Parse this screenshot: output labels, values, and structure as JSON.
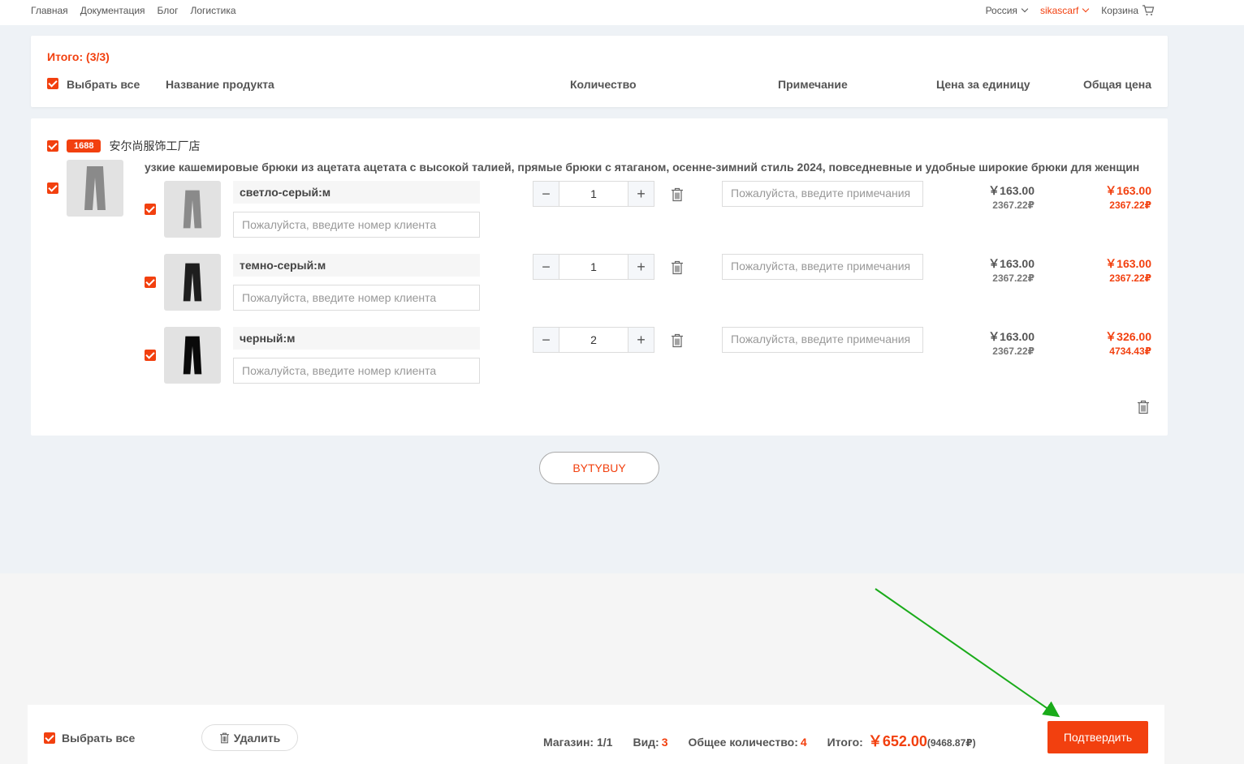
{
  "nav": {
    "links": [
      "Главная",
      "Документация",
      "Блог",
      "Логистика"
    ],
    "region": "Россия",
    "user": "sikascarf",
    "cart": "Корзина"
  },
  "header": {
    "total_label": "Итого:  (3/3)",
    "select_all": "Выбрать все",
    "col_product": "Название продукта",
    "col_qty": "Количество",
    "col_note": "Примечание",
    "col_unit": "Цена за единицу",
    "col_total": "Общая цена"
  },
  "store": {
    "badge": "1688",
    "name": "安尔尚服饰工厂店",
    "product_title": "узкие кашемировые брюки из ацетата ацетата с высокой талией, прямые брюки с ятаганом, осенне-зимний стиль 2024, повседневные и удобные широкие брюки для женщин",
    "variants": [
      {
        "name": "светло-серый:м",
        "qty": "1",
        "unit_price": "￥163.00",
        "unit_rub": "2367.22₽",
        "total_price": "￥163.00",
        "total_rub": "2367.22₽",
        "color": "#8a8a8a"
      },
      {
        "name": "темно-серый:м",
        "qty": "1",
        "unit_price": "￥163.00",
        "unit_rub": "2367.22₽",
        "total_price": "￥163.00",
        "total_rub": "2367.22₽",
        "color": "#1e1e1e"
      },
      {
        "name": "черный:м",
        "qty": "2",
        "unit_price": "￥163.00",
        "unit_rub": "2367.22₽",
        "total_price": "￥326.00",
        "total_rub": "4734.43₽",
        "color": "#0a0a0a"
      }
    ],
    "customer_placeholder": "Пожалуйста, введите номер клиента",
    "note_placeholder": "Пожалуйста, введите примечания"
  },
  "bytybuy": "BYTYBUY",
  "bottom": {
    "select_all": "Выбрать все",
    "delete": "Удалить",
    "stores_label": "Магазин: 1/1",
    "kinds_label": "Вид: ",
    "kinds_value": "3",
    "count_label": "Общее количество: ",
    "count_value": "4",
    "total_label": "Итого: ",
    "total_value": "￥652.00",
    "total_rub": "(9468.87₽)",
    "confirm": "Подтвердить"
  },
  "colors": {
    "accent": "#f2400f",
    "arrow": "#1aab1a"
  }
}
